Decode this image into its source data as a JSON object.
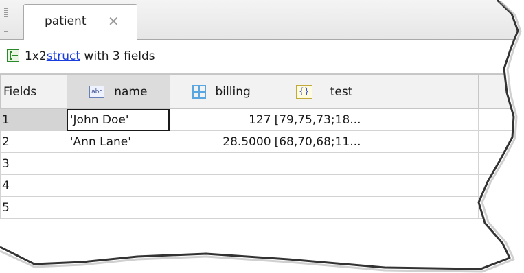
{
  "tab": {
    "title": "patient",
    "close_glyph": "✕"
  },
  "info": {
    "size": "1x2",
    "class_link": "struct",
    "suffix": "with 3 fields",
    "icon": "struct-icon"
  },
  "grid": {
    "corner_label": "Fields",
    "columns": [
      {
        "label": "name",
        "icon": "char-icon",
        "icon_text": "abc"
      },
      {
        "label": "billing",
        "icon": "numeric-array-icon"
      },
      {
        "label": "test",
        "icon": "cell-array-icon",
        "icon_text": "{}"
      }
    ],
    "rows": [
      {
        "index": "1",
        "name": "'John Doe'",
        "billing": "127",
        "test": "[79,75,73;18..."
      },
      {
        "index": "2",
        "name": "'Ann Lane'",
        "billing": "28.5000",
        "test": "[68,70,68;11..."
      },
      {
        "index": "3",
        "name": "",
        "billing": "",
        "test": ""
      },
      {
        "index": "4",
        "name": "",
        "billing": "",
        "test": ""
      },
      {
        "index": "5",
        "name": "",
        "billing": "",
        "test": ""
      }
    ]
  },
  "colors": {
    "link": "#1a3ddd",
    "selected_header": "#dcdcdc",
    "grid_line": "#d3d3d3"
  }
}
